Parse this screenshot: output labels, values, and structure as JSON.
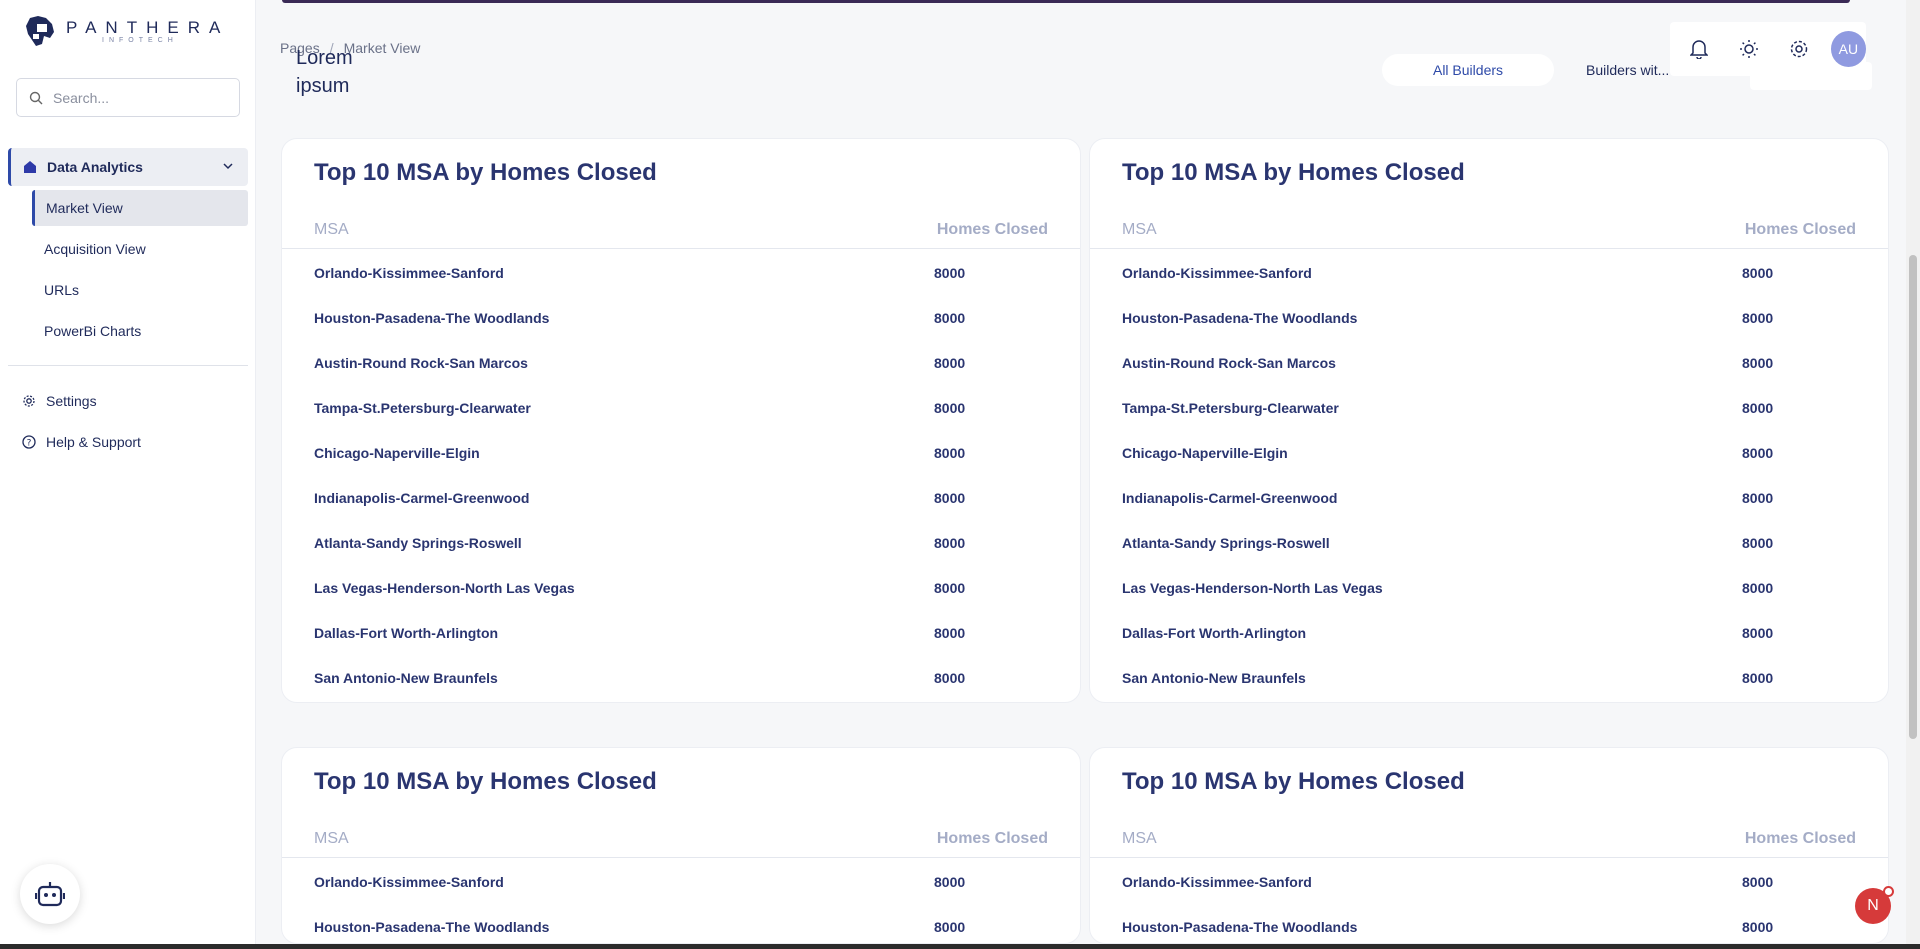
{
  "brand": {
    "name": "PANTHERA",
    "sub": "INFOTECH"
  },
  "search": {
    "placeholder": "Search..."
  },
  "sidebar": {
    "group_label": "Data Analytics",
    "items": [
      {
        "label": "Market View"
      },
      {
        "label": "Acquisition View"
      },
      {
        "label": "URLs"
      },
      {
        "label": "PowerBi Charts"
      }
    ],
    "settings_label": "Settings",
    "help_label": "Help & Support"
  },
  "breadcrumb": {
    "root": "Pages",
    "separator": "/",
    "current": "Market View"
  },
  "page_title": "Lorem ipsum",
  "tabs": [
    {
      "label": "All Builders"
    },
    {
      "label": "Builders wit..."
    }
  ],
  "user": {
    "initials": "AU"
  },
  "notification_badge": "N",
  "cards": [
    {
      "title": "Top 10 MSA by Homes Closed",
      "headers": {
        "msa": "MSA",
        "value": "Homes Closed"
      },
      "rows": [
        {
          "msa": "Orlando-Kissimmee-Sanford",
          "value": "8000"
        },
        {
          "msa": "Houston-Pasadena-The Woodlands",
          "value": "8000"
        },
        {
          "msa": "Austin-Round Rock-San Marcos",
          "value": "8000"
        },
        {
          "msa": "Tampa-St.Petersburg-Clearwater",
          "value": "8000"
        },
        {
          "msa": "Chicago-Naperville-Elgin",
          "value": "8000"
        },
        {
          "msa": "Indianapolis-Carmel-Greenwood",
          "value": "8000"
        },
        {
          "msa": "Atlanta-Sandy Springs-Roswell",
          "value": "8000"
        },
        {
          "msa": "Las Vegas-Henderson-North Las Vegas",
          "value": "8000"
        },
        {
          "msa": "Dallas-Fort Worth-Arlington",
          "value": "8000"
        },
        {
          "msa": "San Antonio-New Braunfels",
          "value": "8000"
        }
      ]
    },
    {
      "title": "Top 10 MSA by Homes Closed",
      "headers": {
        "msa": "MSA",
        "value": "Homes Closed"
      },
      "rows": [
        {
          "msa": "Orlando-Kissimmee-Sanford",
          "value": "8000"
        },
        {
          "msa": "Houston-Pasadena-The Woodlands",
          "value": "8000"
        },
        {
          "msa": "Austin-Round Rock-San Marcos",
          "value": "8000"
        },
        {
          "msa": "Tampa-St.Petersburg-Clearwater",
          "value": "8000"
        },
        {
          "msa": "Chicago-Naperville-Elgin",
          "value": "8000"
        },
        {
          "msa": "Indianapolis-Carmel-Greenwood",
          "value": "8000"
        },
        {
          "msa": "Atlanta-Sandy Springs-Roswell",
          "value": "8000"
        },
        {
          "msa": "Las Vegas-Henderson-North Las Vegas",
          "value": "8000"
        },
        {
          "msa": "Dallas-Fort Worth-Arlington",
          "value": "8000"
        },
        {
          "msa": "San Antonio-New Braunfels",
          "value": "8000"
        }
      ]
    },
    {
      "title": "Top 10 MSA by Homes Closed",
      "headers": {
        "msa": "MSA",
        "value": "Homes Closed"
      },
      "rows": [
        {
          "msa": "Orlando-Kissimmee-Sanford",
          "value": "8000"
        },
        {
          "msa": "Houston-Pasadena-The Woodlands",
          "value": "8000"
        }
      ]
    },
    {
      "title": "Top 10 MSA by Homes Closed",
      "headers": {
        "msa": "MSA",
        "value": "Homes Closed"
      },
      "rows": [
        {
          "msa": "Orlando-Kissimmee-Sanford",
          "value": "8000"
        },
        {
          "msa": "Houston-Pasadena-The Woodlands",
          "value": "8000"
        }
      ]
    }
  ],
  "colors": {
    "accent": "#2e4aa8",
    "text": "#1f2a5a",
    "header_muted": "#a4acc6",
    "avatar": "#8f9ae0",
    "badge": "#d63a3a"
  }
}
